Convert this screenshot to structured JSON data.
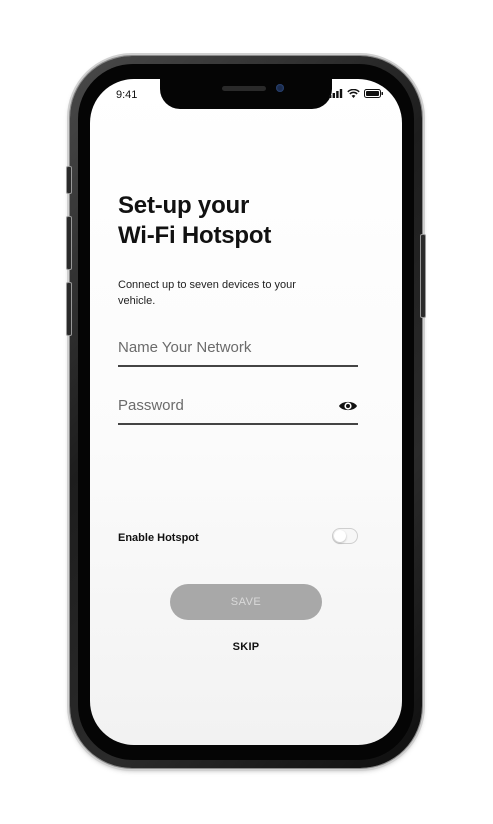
{
  "status_bar": {
    "time": "9:41",
    "icons": [
      "signal-icon",
      "wifi-icon",
      "battery-icon"
    ]
  },
  "header": {
    "title_line1": "Set-up your",
    "title_line2": "Wi-Fi Hotspot",
    "subtitle": "Connect up to seven devices to your vehicle."
  },
  "form": {
    "network_name": {
      "placeholder": "Name Your Network",
      "value": ""
    },
    "password": {
      "placeholder": "Password",
      "value": "",
      "visibility_icon": "eye-icon"
    }
  },
  "hotspot": {
    "label": "Enable Hotspot",
    "enabled": false
  },
  "actions": {
    "save_label": "SAVE",
    "save_disabled": true,
    "skip_label": "SKIP"
  },
  "colors": {
    "text_primary": "#111111",
    "placeholder": "#6b6b6b",
    "save_disabled_bg": "#a8a8a8",
    "save_disabled_text": "#d9d9d9",
    "field_underline": "#444444"
  }
}
